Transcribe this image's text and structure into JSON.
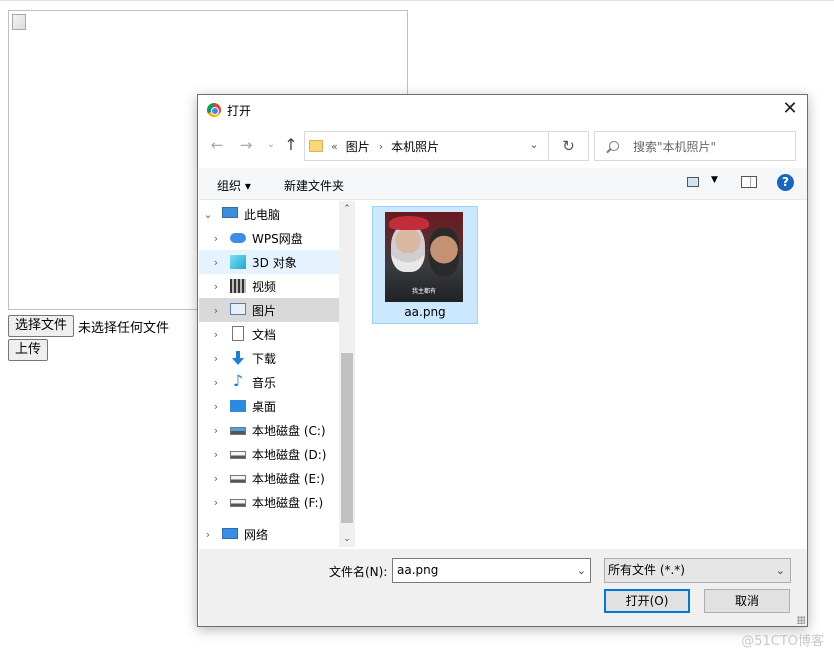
{
  "page": {
    "choose_file_label": "选择文件",
    "no_file_text": "未选择任何文件",
    "upload_label": "上传"
  },
  "dialog": {
    "title": "打开",
    "close_glyph": "✕",
    "nav": {
      "back_glyph": "←",
      "forward_glyph": "→",
      "recent_glyph": "⌄",
      "up_glyph": "↑",
      "breadcrumb_overflow": "«",
      "breadcrumb": [
        "图片",
        "本机照片"
      ],
      "breadcrumb_sep": "›",
      "address_dropdown_glyph": "⌄",
      "refresh_glyph": "↻",
      "search_placeholder": "搜索\"本机照片\""
    },
    "toolbar": {
      "organize_label": "组织 ▾",
      "new_folder_label": "新建文件夹",
      "view_dropdown_glyph": "▼",
      "help_label": "?"
    },
    "tree": [
      {
        "label": "此电脑",
        "icon": "computer-icon",
        "expander": "⌄",
        "state": "normal"
      },
      {
        "label": "WPS网盘",
        "icon": "cloud-icon",
        "expander": "›",
        "state": "normal"
      },
      {
        "label": "3D 对象",
        "icon": "3d-objects-icon",
        "expander": "›",
        "state": "hover"
      },
      {
        "label": "视频",
        "icon": "video-icon",
        "expander": "›",
        "state": "normal"
      },
      {
        "label": "图片",
        "icon": "pictures-icon",
        "expander": "›",
        "state": "selected"
      },
      {
        "label": "文档",
        "icon": "document-icon",
        "expander": "›",
        "state": "normal"
      },
      {
        "label": "下载",
        "icon": "download-icon",
        "expander": "›",
        "state": "normal"
      },
      {
        "label": "音乐",
        "icon": "music-icon",
        "expander": "›",
        "state": "normal"
      },
      {
        "label": "桌面",
        "icon": "desktop-icon",
        "expander": "›",
        "state": "normal"
      },
      {
        "label": "本地磁盘 (C:)",
        "icon": "system-drive-icon",
        "expander": "›",
        "state": "normal"
      },
      {
        "label": "本地磁盘 (D:)",
        "icon": "drive-icon",
        "expander": "›",
        "state": "normal"
      },
      {
        "label": "本地磁盘 (E:)",
        "icon": "drive-icon",
        "expander": "›",
        "state": "normal"
      },
      {
        "label": "本地磁盘 (F:)",
        "icon": "drive-icon",
        "expander": "›",
        "state": "normal"
      },
      {
        "label": "网络",
        "icon": "network-icon",
        "expander": "›",
        "state": "normal"
      }
    ],
    "scroll": {
      "up_glyph": "⌃",
      "down_glyph": "⌄"
    },
    "files": [
      {
        "name": "aa.png",
        "thumbnail_caption": "我主都有"
      }
    ],
    "filename_label": "文件名(N):",
    "filename_value": "aa.png",
    "filename_dropdown_glyph": "⌄",
    "filetype_value": "所有文件 (*.*)",
    "filetype_dropdown_glyph": "⌄",
    "open_label": "打开(O)",
    "cancel_label": "取消"
  },
  "watermark": "@51CTO博客",
  "colors": {
    "selection_bg": "#cce8ff",
    "selection_border": "#99d1ff",
    "primary_button_border": "#0078d7",
    "tree_selected_bg": "#d9d9d9",
    "tree_hover_bg": "#e5f3ff"
  }
}
